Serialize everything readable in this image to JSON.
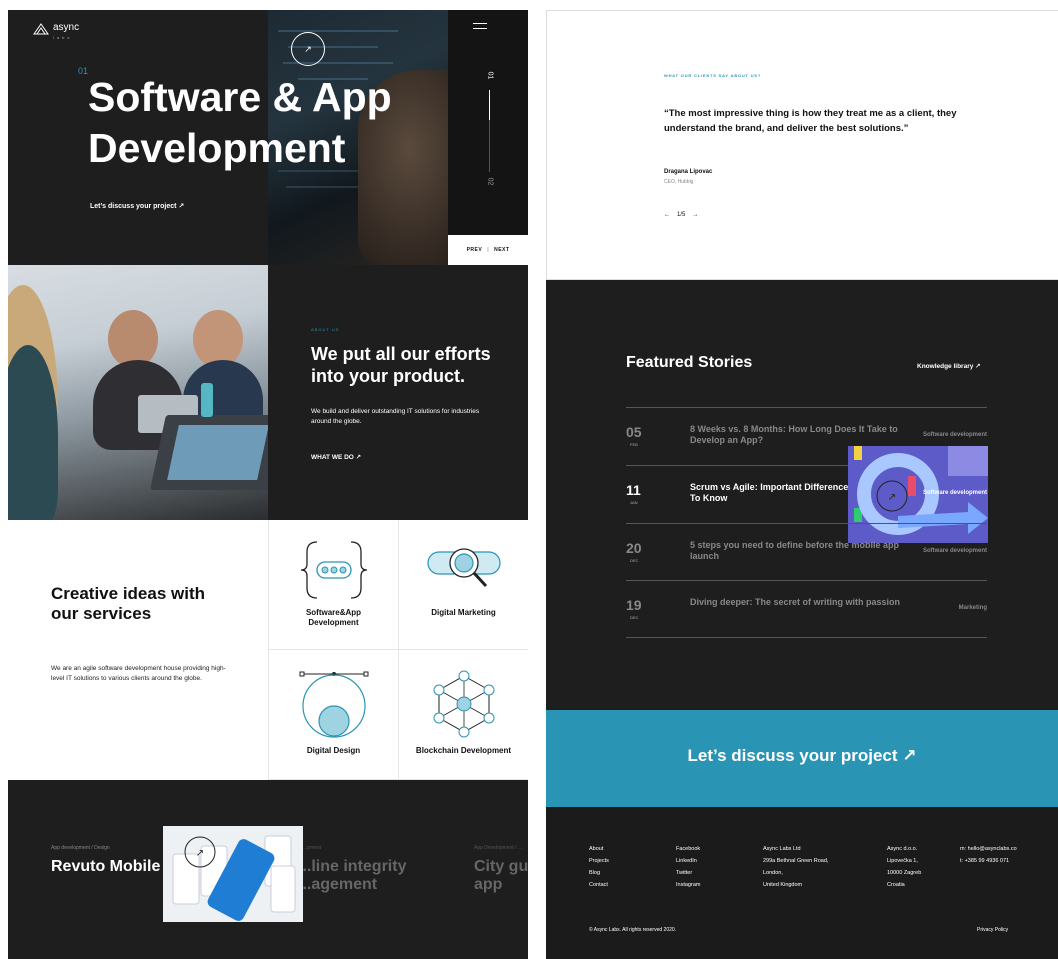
{
  "hero": {
    "logo_word": "async",
    "logo_sub": "labs",
    "slide_number": "01",
    "title": "Software & App Development",
    "cta": "Let’s discuss your project ↗",
    "circle_icon": "↗",
    "slide_top": "01",
    "slide_bottom": "02",
    "prev": "PREV",
    "next": "NEXT",
    "sep": "|"
  },
  "about": {
    "label": "ABOUT US",
    "title": "We put all our efforts into your product.",
    "description": "We build and deliver outstanding IT solutions for industries around the globe.",
    "link": "WHAT WE DO ↗"
  },
  "services": {
    "title": "Creative ideas with our services",
    "description": "We are an agile software development house providing high-level IT solutions to various clients around the globe.",
    "items": [
      {
        "label": "Software&App Development",
        "icon": "code-braces-icon"
      },
      {
        "label": "Digital Marketing",
        "icon": "search-magnifier-icon"
      },
      {
        "label": "Digital Design",
        "icon": "vector-circle-icon"
      },
      {
        "label": "Blockchain Development",
        "icon": "blockchain-network-icon"
      }
    ]
  },
  "projects": {
    "items": [
      {
        "category": "App development / Design",
        "title": "Revuto Mobile"
      },
      {
        "category": "...pment",
        "title": "...line integrity ...agement"
      },
      {
        "category": "App Development / ...",
        "title": "City gu... app"
      }
    ]
  },
  "testimonial": {
    "label": "WHAT OUR CLIENTS SAY ABOUT US?",
    "quote": "“The most impressive thing is how they treat me as a client, they understand the brand, and deliver the best solutions.”",
    "name": "Dragana Lipovac",
    "role": "CEO, Hubbig",
    "prev": "←",
    "counter": "1/5",
    "next": "→"
  },
  "stories": {
    "title": "Featured Stories",
    "link": "Knowledge library ↗",
    "items": [
      {
        "day": "05",
        "month": "FEB",
        "title": "8 Weeks vs. 8 Months: How Long Does It Take to Develop an App?",
        "category": "Software development"
      },
      {
        "day": "11",
        "month": "JAN",
        "title": "Scrum vs Agile: Important Differences You Need To Know",
        "category": "Software development"
      },
      {
        "day": "20",
        "month": "DEC",
        "title": "5 steps you need to define before the mobile app launch",
        "category": "Software development"
      },
      {
        "day": "19",
        "month": "DEC",
        "title": "Diving deeper: The secret of writing with passion",
        "category": "Marketing"
      }
    ]
  },
  "cta": {
    "text": "Let’s discuss your project ↗"
  },
  "footer": {
    "col1": [
      "About",
      "Projects",
      "Blog",
      "Contact"
    ],
    "col2": [
      "Facebook",
      "LinkedIn",
      "Twitter",
      "Instagram"
    ],
    "col3": [
      "Async Labs Ltd",
      "299a Bethnal Green Road,",
      "London,",
      "United Kingdom"
    ],
    "col4": [
      "Async d.o.o.",
      "Lipovečka 1,",
      "10000 Zagreb",
      "Croatia"
    ],
    "col5": [
      "m: hello@asynclabs.co",
      "t: +385 99 4936 071"
    ],
    "copyright": "© Async Labs. All rights reserved 2020.",
    "privacy": "Privacy Policy"
  },
  "colors": {
    "accent": "#2a94b4",
    "dark": "#1e1e1e"
  }
}
